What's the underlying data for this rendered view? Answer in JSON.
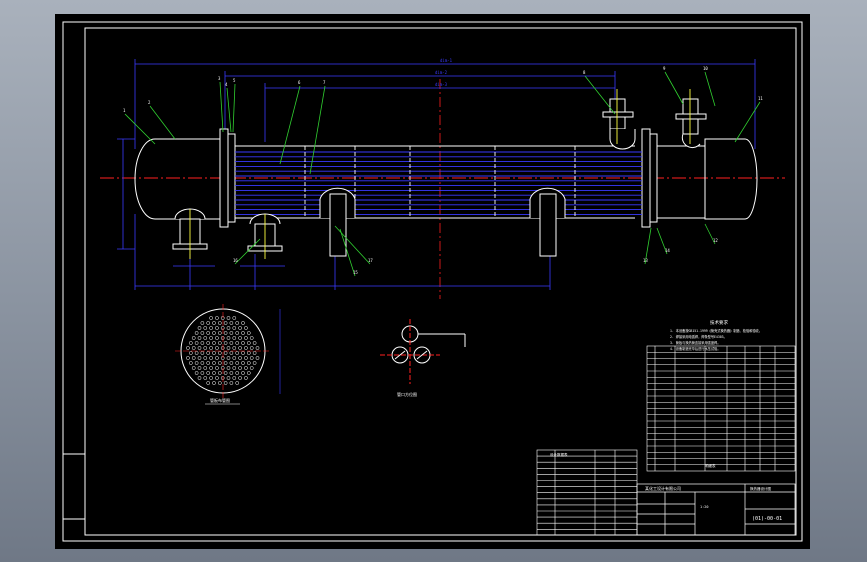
{
  "drawing": {
    "title_block": {
      "drawing_number": "(01)-00-01",
      "company": "某化工设计有限公司",
      "project": "换热器设计图",
      "scale": "1:20"
    },
    "notes_title": "技术要求",
    "notes": [
      "1. 本设备按GB151-1999《管壳式换热器》制造、检验和验收。",
      "2. 焊接采用电弧焊，焊条型号E4303。",
      "3. 管板与换热管连接采用强度焊。",
      "4. 设备制造完毕后进行水压试验。"
    ],
    "views": {
      "main": "主视图",
      "tubesheet": "管板布管图",
      "detail": "管口方位图"
    },
    "balloons": [
      "1",
      "2",
      "3",
      "4",
      "5",
      "6",
      "7",
      "8",
      "9",
      "10",
      "11",
      "12",
      "13",
      "14",
      "15",
      "16",
      "17"
    ],
    "parts_list_title": "明细表",
    "design_data_title": "设计数据表",
    "colors": {
      "background": "#000000",
      "lines": "#ffffff",
      "tubes": "#3a3aff",
      "centerline": "#ff2020",
      "dimensions": "#3a3aff",
      "leaders": "#30d030",
      "nozzles": "#ffff40"
    }
  }
}
